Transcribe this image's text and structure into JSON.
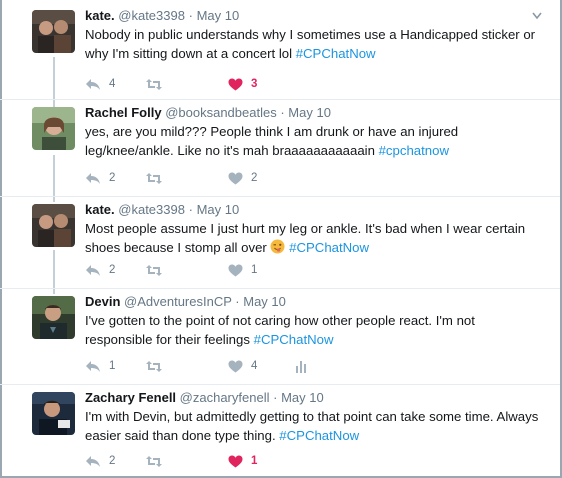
{
  "colors": {
    "hashtag": "#1b95e0",
    "secondary_text": "#657786",
    "liked_heart": "#e0245e",
    "icon_gray": "#a4b3be",
    "thread_line": "#c4d0d8"
  },
  "tweets": [
    {
      "name": "kate.",
      "handle": "@kate3398",
      "dot": "·",
      "time": "May 10",
      "text": "Nobody in public understands why I sometimes use a Handicapped sticker or why I'm sitting down at a concert lol",
      "hashtag": "#CPChatNow",
      "reply_count": "4",
      "like_count": "3",
      "liked": true,
      "avatar_icon": "user-photo"
    },
    {
      "name": "Rachel Folly",
      "handle": "@booksandbeatles",
      "dot": "·",
      "time": "May 10",
      "text": "yes, are you mild??? People think I am drunk or have an injured leg/knee/ankle. Like no it's mah braaaaaaaaaaain",
      "hashtag": "#cpchatnow",
      "reply_count": "2",
      "like_count": "2",
      "liked": false,
      "avatar_icon": "user-photo"
    },
    {
      "name": "kate.",
      "handle": "@kate3398",
      "dot": "·",
      "time": "May 10",
      "text": "Most people assume I just hurt my leg or ankle. It's bad when I wear certain shoes because I stomp all over",
      "emoji": "face-with-tongue-winking-emoji",
      "hashtag": "#CPChatNow",
      "reply_count": "2",
      "like_count": "1",
      "liked": false,
      "avatar_icon": "user-photo"
    },
    {
      "name": "Devin",
      "handle": "@AdventuresInCP",
      "dot": "·",
      "time": "May 10",
      "text": "I've gotten to the point of not caring how other people react. I'm not responsible for their feelings",
      "hashtag": "#CPChatNow",
      "reply_count": "1",
      "like_count": "4",
      "liked": false,
      "avatar_icon": "user-photo"
    },
    {
      "name": "Zachary Fenell",
      "handle": "@zacharyfenell",
      "dot": "·",
      "time": "May 10",
      "text": "I'm with Devin, but admittedly getting to that point can take some time. Always easier said than done type thing.",
      "hashtag": "#CPChatNow",
      "reply_count": "2",
      "like_count": "1",
      "liked": true,
      "avatar_icon": "user-photo"
    }
  ]
}
